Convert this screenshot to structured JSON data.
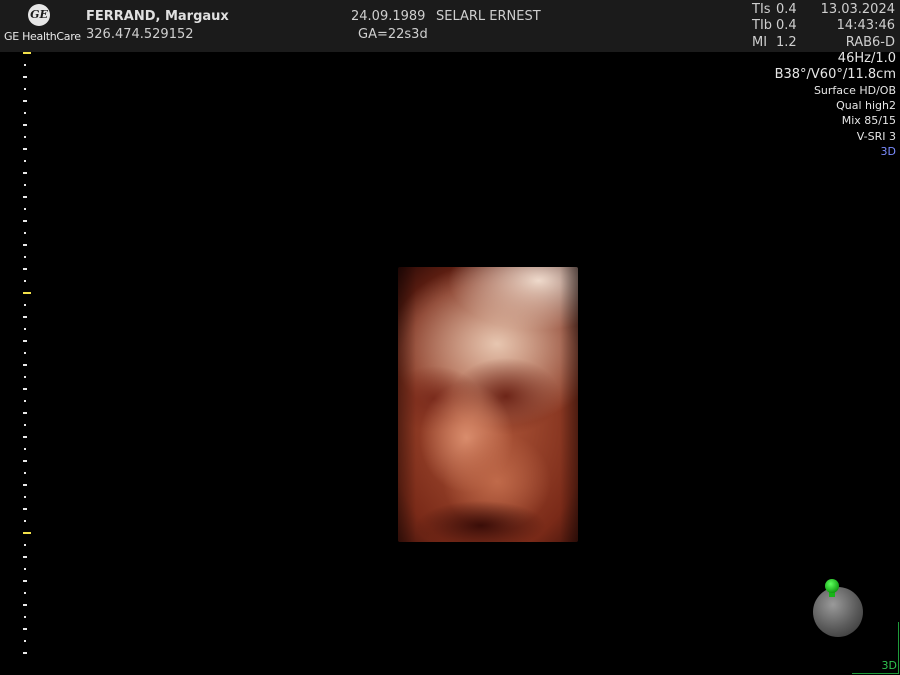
{
  "header": {
    "logo_monogram": "GE",
    "logo_text": "GE HealthCare",
    "patient_name": "FERRAND, Margaux",
    "patient_id": "326.474.529152",
    "birth_date": "24.09.1989",
    "clinic": "SELARL ERNEST",
    "gestational_age": "GA=22s3d",
    "thermal_indices": [
      {
        "label": "TIs",
        "value": "0.4"
      },
      {
        "label": "TIb",
        "value": "0.4"
      },
      {
        "label": "MI",
        "value": "1.2"
      }
    ],
    "date": "13.03.2024",
    "time": "14:43:46",
    "probe": "RAB6-D"
  },
  "imaging_params": [
    "46Hz/1.0",
    "B38°/V60°/11.8cm",
    "Surface HD/OB",
    "Qual high2",
    "Mix 85/15",
    "V-SRI 3",
    "3D"
  ],
  "colors": {
    "accent_blue": "#7b8cff",
    "scale_marker": "#f2e14a",
    "orientation_marker": "#2fc24f"
  },
  "icons": {
    "orientation": "orientation-ball-icon",
    "logo": "ge-logo-icon"
  },
  "corner_label": "3D"
}
